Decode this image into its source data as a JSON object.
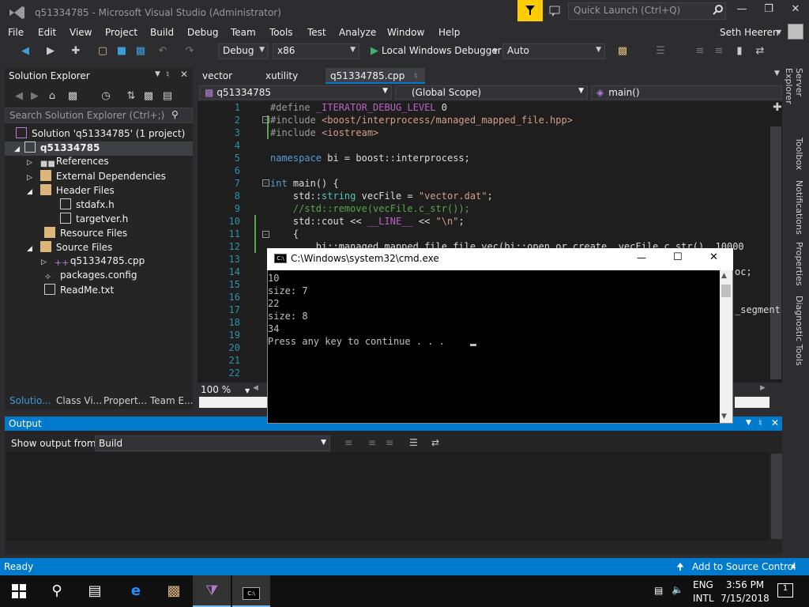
{
  "window": {
    "title": "q51334785 - Microsoft Visual Studio (Administrator)",
    "quick_launch_placeholder": "Quick Launch (Ctrl+Q)",
    "user": "Seth Heeren"
  },
  "menu": [
    "File",
    "Edit",
    "View",
    "Project",
    "Build",
    "Debug",
    "Team",
    "Tools",
    "Test",
    "Analyze",
    "Window",
    "Help"
  ],
  "toolbar": {
    "config": "Debug",
    "platform": "x86",
    "run_label": "Local Windows Debugger",
    "run_mode": "Auto"
  },
  "solution_explorer": {
    "title": "Solution Explorer",
    "search_placeholder": "Search Solution Explorer (Ctrl+;)",
    "solution": "Solution 'q51334785' (1 project)",
    "project": "q51334785",
    "items": [
      {
        "label": "References"
      },
      {
        "label": "External Dependencies"
      },
      {
        "label": "Header Files"
      },
      {
        "label": "stdafx.h"
      },
      {
        "label": "targetver.h"
      },
      {
        "label": "Resource Files"
      },
      {
        "label": "Source Files"
      },
      {
        "label": "q51334785.cpp"
      },
      {
        "label": "packages.config"
      },
      {
        "label": "ReadMe.txt"
      }
    ],
    "tabs": [
      "Solutio...",
      "Class Vi...",
      "Propert...",
      "Team E..."
    ]
  },
  "editor": {
    "tabs": [
      "vector",
      "xutility",
      "q51334785.cpp"
    ],
    "nav_project": "q51334785",
    "nav_scope": "(Global Scope)",
    "nav_member": "main()",
    "zoom": "100 %",
    "line_numbers": [
      "1",
      "2",
      "3",
      "4",
      "5",
      "6",
      "7",
      "8",
      "9",
      "10",
      "11",
      "12",
      "13",
      "14",
      "15",
      "16",
      "17",
      "18",
      "19",
      "20",
      "21",
      "22"
    ],
    "lines": {
      "l1a": "#define ",
      "l1b": "_ITERATOR_DEBUG_LEVEL",
      "l1c": " 0",
      "l2a": "#include ",
      "l2b": "<boost/interprocess/managed_mapped_file.hpp>",
      "l3a": "#include ",
      "l3b": "<iostream>",
      "l5a": "namespace",
      "l5b": " bi = boost::interprocess;",
      "l7a": "int",
      "l7b": " main() {",
      "l8a": "    std::",
      "l8b": "string",
      "l8c": " vecFile = ",
      "l8d": "\"vector.dat\"",
      "l8e": ";",
      "l9": "    //std::remove(vecFile.c_str());",
      "l10a": "    std::cout << ",
      "l10b": "__LINE__",
      "l10c": " << ",
      "l10d": "\"\\n\"",
      "l10e": ";",
      "l11": "    {",
      "l12": "        bi::managed_mapped_file file_vec(bi::open_or_create, vecFile.c_str(), 100000);",
      "l14tail": "oc;",
      "l17tail": "_segment"
    }
  },
  "side_tabs": [
    "Server Explorer",
    "Toolbox",
    "Notifications",
    "Properties",
    "Diagnostic Tools"
  ],
  "output": {
    "title": "Output",
    "show_from_label": "Show output from:",
    "source": "Build"
  },
  "status": {
    "ready": "Ready",
    "source_control": "Add to Source Control"
  },
  "cmd": {
    "title": "C:\\Windows\\system32\\cmd.exe",
    "lines": [
      "10",
      "size: 7",
      "22",
      "size: 8",
      "34",
      "Press any key to continue . . . "
    ]
  },
  "taskbar": {
    "lang1": "ENG",
    "lang2": "INTL",
    "time": "3:56 PM",
    "date": "7/15/2018",
    "notifications_count": "1"
  },
  "colors": {
    "accent": "#007acc",
    "feedback": "#ffcc00",
    "editor_bg": "#1e1e1e"
  }
}
